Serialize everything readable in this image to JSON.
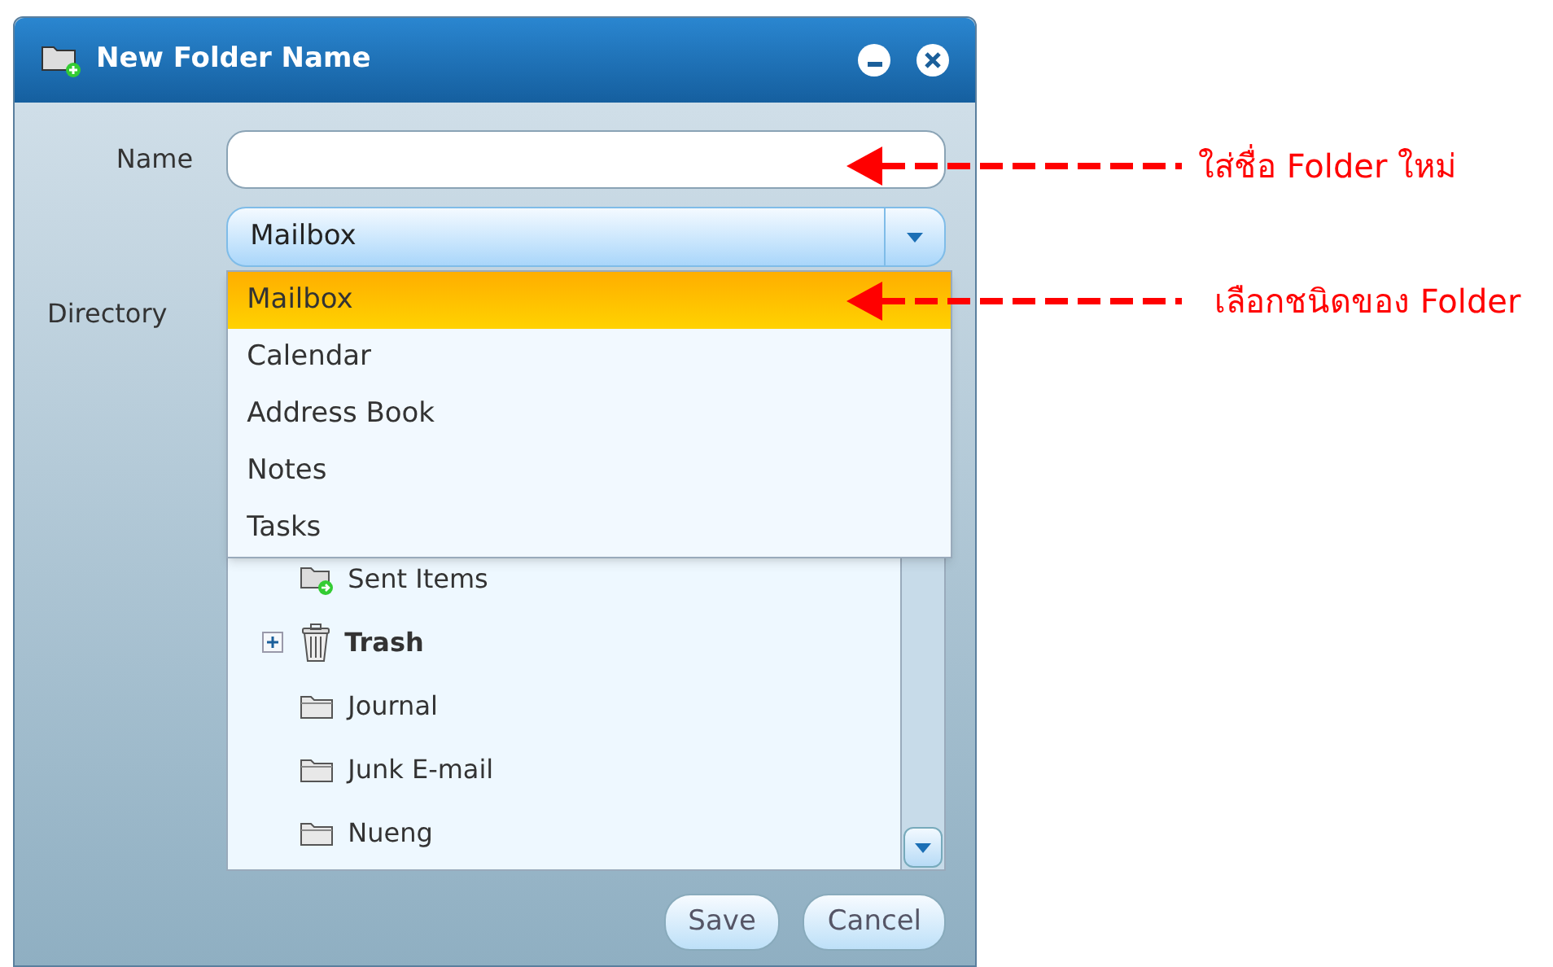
{
  "window": {
    "title": "New Folder Name"
  },
  "name_field": {
    "label": "Name"
  },
  "directory": {
    "label": "Directory",
    "value": "Mailbox",
    "expanded": true,
    "options": [
      {
        "label": "Mailbox",
        "selected": true
      },
      {
        "label": "Calendar",
        "selected": false
      },
      {
        "label": "Address Book",
        "selected": false
      },
      {
        "label": "Notes",
        "selected": false
      },
      {
        "label": "Tasks",
        "selected": false
      }
    ]
  },
  "tree": [
    {
      "label": "Sent Items",
      "kind": "sent",
      "bold": false
    },
    {
      "label": "Trash",
      "kind": "trash",
      "bold": true,
      "expanded": false
    },
    {
      "label": "Journal",
      "kind": "folder",
      "bold": false
    },
    {
      "label": "Junk E-mail",
      "kind": "folder",
      "bold": false
    },
    {
      "label": "Nueng",
      "kind": "folder",
      "bold": false
    }
  ],
  "buttons": [
    "Save",
    "Cancel"
  ],
  "annotations": [
    {
      "text": "ใส่ชื่อ Folder ใหม่"
    },
    {
      "text": "เลือกชนิดของ Folder"
    }
  ]
}
